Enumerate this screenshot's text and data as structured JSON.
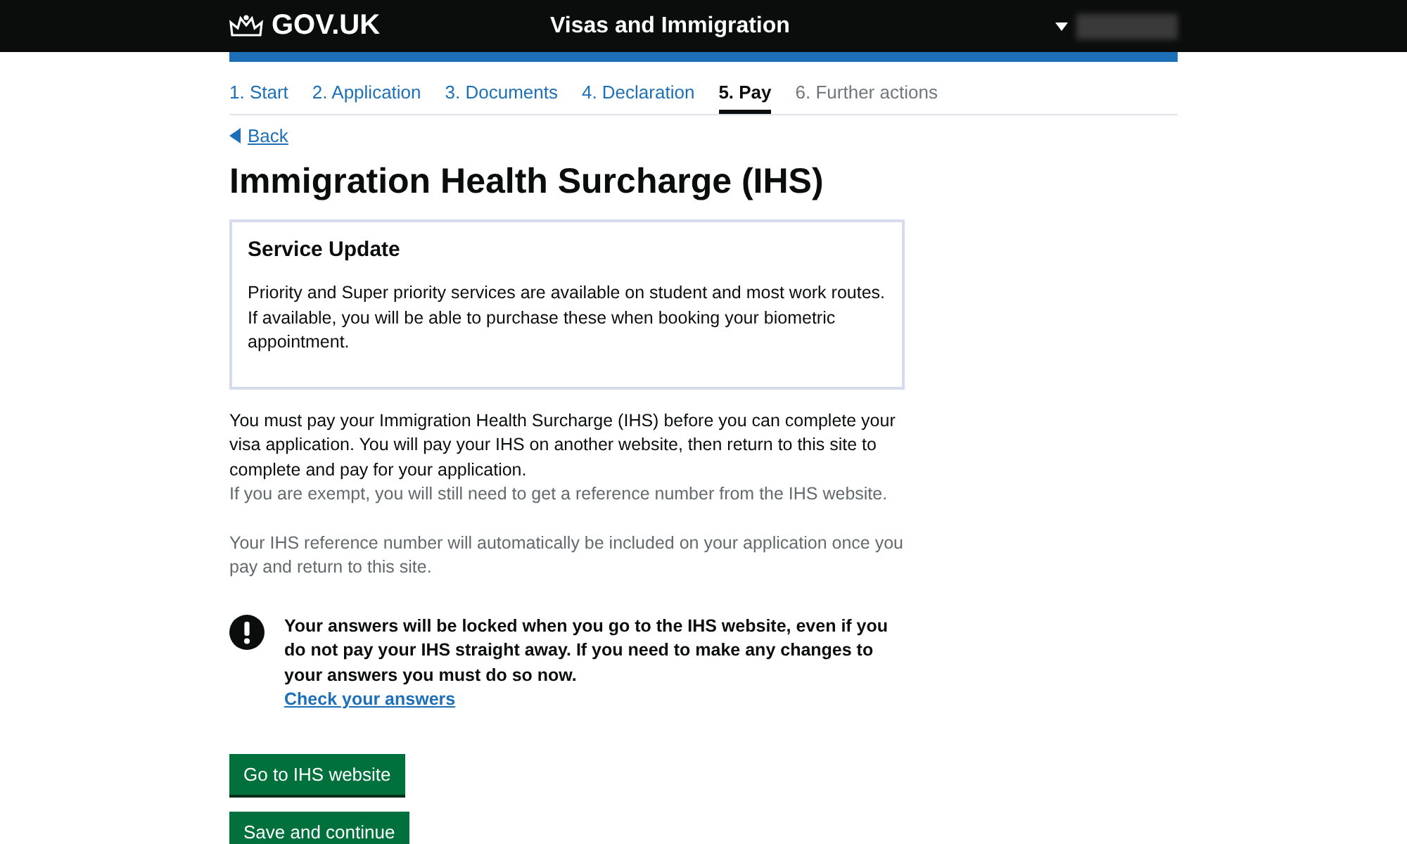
{
  "header": {
    "logo": "GOV.UK",
    "service": "Visas and Immigration"
  },
  "steps": [
    {
      "label": "1. Start",
      "selected": false,
      "disabled": false
    },
    {
      "label": "2. Application",
      "selected": false,
      "disabled": false
    },
    {
      "label": "3. Documents",
      "selected": false,
      "disabled": false
    },
    {
      "label": "4. Declaration",
      "selected": false,
      "disabled": false
    },
    {
      "label": "5. Pay",
      "selected": true,
      "disabled": false
    },
    {
      "label": "6. Further actions",
      "selected": false,
      "disabled": true
    }
  ],
  "back_link": "Back",
  "heading": "Immigration Health Surcharge (IHS)",
  "notice": {
    "title": "Service Update",
    "body": "Priority and Super priority services are available on student and most work routes. If available, you will be able to purchase these when booking your biometric appointment."
  },
  "paragraphs": [
    {
      "text": "You must pay your Immigration Health Surcharge (IHS) before you can complete your visa application. You will pay your IHS on another website, then return to this site to complete and pay for your application.",
      "muted": false
    },
    {
      "text": "If you are exempt, you will still need to get a reference number from the IHS website.",
      "muted": true
    },
    {
      "text": "Your IHS reference number will automatically be included on your application once you pay and return to this site.",
      "muted": true
    }
  ],
  "warning": {
    "text": "Your answers will be locked when you go to the IHS website, even if you do not pay your IHS straight away. If you need to make any changes to your answers you must do so now.",
    "link": "Check your answers"
  },
  "buttons": [
    "Go to IHS website",
    "Save and continue"
  ]
}
